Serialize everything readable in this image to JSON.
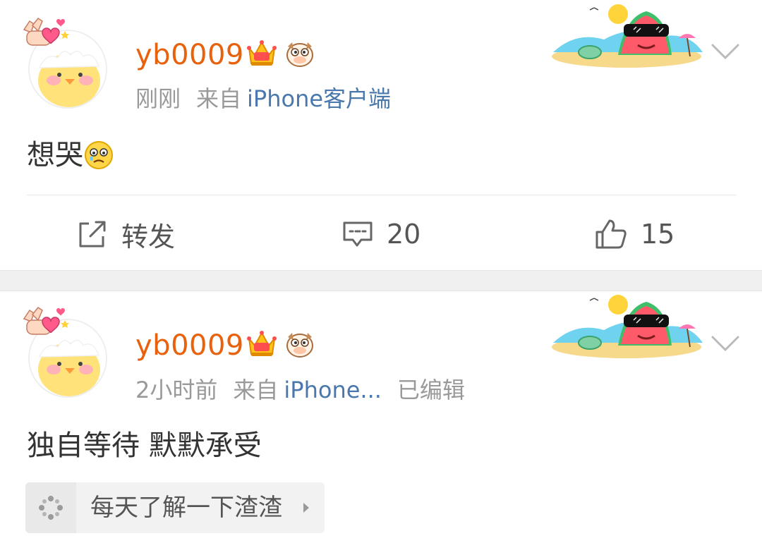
{
  "posts": [
    {
      "username": "yb0009",
      "time": "刚刚",
      "source_prefix": "来自",
      "source": "iPhone客户端",
      "text": "想哭",
      "text_emoji": "crying-face-emoji",
      "actions": {
        "repost": "转发",
        "comments": "20",
        "likes": "15"
      }
    },
    {
      "username": "yb0009",
      "time": "2小时前",
      "source_prefix": "来自",
      "source": "iPhone...",
      "edited": "已编辑",
      "text": "独自等待 默默承受",
      "topic": "每天了解一下渣渣"
    }
  ],
  "icons": {
    "crown": "crown-badge-icon",
    "cow": "cow-face-badge-icon",
    "chevron": "chevron-down-icon",
    "repost": "repost-icon",
    "comment": "comment-icon",
    "like": "thumbs-up-icon",
    "topic": "topic-sparkle-icon",
    "card": "watermelon-beach-card-decoration"
  },
  "colors": {
    "username": "#e8610d",
    "source_link": "#4a78ad",
    "meta": "#999999",
    "text": "#333333",
    "separator": "#f0f0f0"
  }
}
